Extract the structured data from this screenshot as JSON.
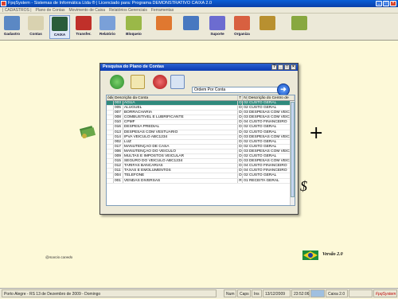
{
  "window": {
    "title": "FpqSystem - Sistemas de Informática Ltda ® | Licenciado para: Programa DEMONSTRATIVO CAIXA 2.0"
  },
  "menu": [
    "| CADASTROS |",
    "Plano de Contas",
    "Movimento de Caixa",
    "Relatórios Gerenciais",
    "Ferramentas"
  ],
  "toolbar": [
    {
      "label": "Gadastro",
      "icon": "user-icon",
      "color": "#5b88c4"
    },
    {
      "label": "Contas",
      "icon": "abc-icon",
      "color": "#d9d2b0"
    },
    {
      "label": "CAIXA",
      "icon": "cash-register-icon",
      "color": "#2a5c3a"
    },
    {
      "label": "Transfer.",
      "icon": "transfer-icon",
      "color": "#c0302a"
    },
    {
      "label": "Relatório",
      "icon": "report-icon",
      "color": "#7aa0d8"
    },
    {
      "label": "Bloqueio",
      "icon": "lock-icon",
      "color": "#9ab848"
    },
    {
      "label": "",
      "icon": "calculator-icon",
      "color": "#e07830"
    },
    {
      "label": "",
      "icon": "book-icon",
      "color": "#4878c0"
    },
    {
      "label": "Suporte",
      "icon": "support-icon",
      "color": "#6c6cd0"
    },
    {
      "label": "Organiza",
      "icon": "tools-icon",
      "color": "#d86040"
    },
    {
      "label": "",
      "icon": "coin-icon",
      "color": "#b89030"
    },
    {
      "label": "",
      "icon": "exit-icon",
      "color": "#88a840"
    }
  ],
  "dialog": {
    "title": "Pesquisa do Plano de Contas",
    "order_value": "Ordem Por Conta",
    "columns": [
      "ódigo",
      "Descrição da Conta",
      "T",
      "N",
      "Descrição do Centro de"
    ],
    "rows": [
      [
        "",
        "003",
        "ÁGUA",
        "D",
        "02 CUSTO GERAL"
      ],
      [
        "",
        "005",
        "ALUGUEL",
        "D",
        "02 CUSTO GERAL"
      ],
      [
        "",
        "007",
        "BORRACHARIA",
        "D",
        "03 DESPESAS COM VEIC"
      ],
      [
        "",
        "008",
        "COMBUSTIVEL E LUBRIFICANTE",
        "D",
        "03 DESPESAS COM VEIC"
      ],
      [
        "",
        "010",
        "CPMF",
        "D",
        "04 CUSTO FINANCEIRO"
      ],
      [
        "",
        "016",
        "DESPESA PREDIAL",
        "D",
        "02 CUSTO GERAL"
      ],
      [
        "",
        "013",
        "DESPESAS COM VESTUÁRIO",
        "D",
        "02 CUSTO GERAL"
      ],
      [
        "",
        "014",
        "IPVA VEICULO ABC1234",
        "D",
        "03 DESPESAS COM VEIC"
      ],
      [
        "",
        "002",
        "LUZ",
        "D",
        "02 CUSTO GERAL"
      ],
      [
        "",
        "017",
        "MANUTENÇÃO DE CASA",
        "D",
        "02 CUSTO GERAL"
      ],
      [
        "",
        "006",
        "MANUTENÇÃO DO VEICULO",
        "D",
        "03 DESPESAS COM VEIC"
      ],
      [
        "",
        "009",
        "MULTAS E IMPOSTOS VEICULAR",
        "D",
        "02 CUSTO GERAL"
      ],
      [
        "",
        "015",
        "SEGURO DO VEICULO ABC1234",
        "D",
        "03 DESPESAS COM VEIC"
      ],
      [
        "",
        "012",
        "TARIFAS BANCARIAS",
        "D",
        "04 CUSTO FINANCEIRO"
      ],
      [
        "",
        "011",
        "TAXAS E EMOLUMENTOS",
        "D",
        "04 CUSTO FINANCEIRO"
      ],
      [
        "",
        "004",
        "TELEFONE",
        "D",
        "02 CUSTO GERAL"
      ],
      [
        "",
        "001",
        "VENDAS DIVERSAS",
        "R",
        "01 RECEITA GERAL"
      ]
    ]
  },
  "main": {
    "version": "Versão 2.0",
    "signature": "@marcio canedo"
  },
  "status": {
    "location": "Porto Alegre - RS 13 de Dezembro de 2009 - Domingo",
    "num": "Num",
    "caps": "Caps",
    "ins": "Ins",
    "date": "13/12/2009",
    "time": "23:52:06",
    "app": "Caixa 2.0",
    "brand": "FpqSystem"
  }
}
